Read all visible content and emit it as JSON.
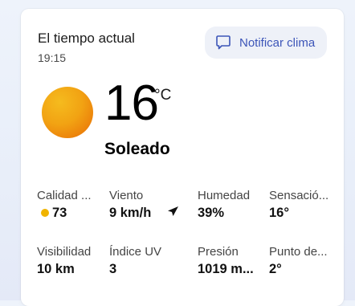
{
  "header": {
    "title": "El tiempo actual",
    "time": "19:15",
    "notify_label": "Notificar clima"
  },
  "current": {
    "temperature": "16",
    "unit": "°C",
    "condition": "Soleado",
    "icon": "sun-icon"
  },
  "metrics": [
    {
      "label": "Calidad ...",
      "value": "73",
      "icon": "air-quality-dot-icon",
      "color": "#f0b400"
    },
    {
      "label": "Viento",
      "value": "9 km/h",
      "icon": "wind-direction-arrow-icon"
    },
    {
      "label": "Humedad",
      "value": "39%"
    },
    {
      "label": "Sensació...",
      "value": "16°"
    },
    {
      "label": "Visibilidad",
      "value": "10 km"
    },
    {
      "label": "Índice UV",
      "value": "3"
    },
    {
      "label": "Presión",
      "value": "1019 m..."
    },
    {
      "label": "Punto de...",
      "value": "2°"
    }
  ],
  "colors": {
    "accent": "#3c55b8",
    "sun_start": "#f5bb1e",
    "sun_end": "#e86a05",
    "air_quality_dot": "#f0b400"
  }
}
